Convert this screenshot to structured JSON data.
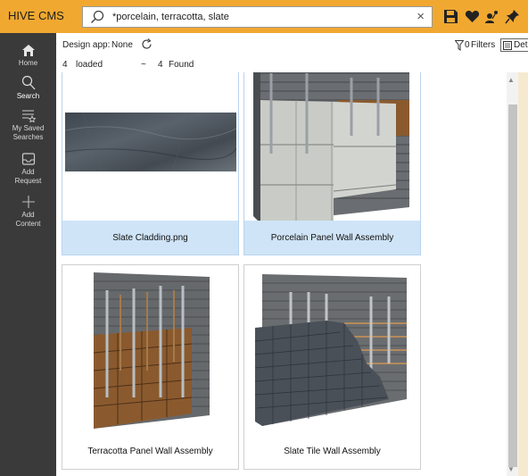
{
  "app": {
    "title": "HIVE CMS"
  },
  "search": {
    "value": "*porcelain, terracotta, slate",
    "clear_label": "×"
  },
  "toolbar_icons": [
    "save-icon",
    "heart-icon",
    "share-user-icon",
    "pin-icon"
  ],
  "sidebar": {
    "items": [
      {
        "label": "Home",
        "icon": "home-icon"
      },
      {
        "label": "Search",
        "icon": "search-icon"
      },
      {
        "label": "My Saved Searches",
        "icon": "saved-searches-icon"
      },
      {
        "label": "Add Request",
        "icon": "add-request-icon"
      },
      {
        "label": "Add Content",
        "icon": "add-content-icon"
      }
    ],
    "home_label": "Home",
    "search_label": "Search",
    "saved_line1": "My Saved",
    "saved_line2": "Searches",
    "request_line1": "Add",
    "request_line2": "Request",
    "content_line1": "Add",
    "content_line2": "Content"
  },
  "info": {
    "design_app_label": "Design app:",
    "design_app_value": "None",
    "loaded_count": "4",
    "loaded_label": "loaded",
    "found_prefix": "~",
    "found_count": "4",
    "found_label": "Found",
    "filters_count": "0",
    "filters_label": "Filters",
    "details_label": "Details"
  },
  "results": [
    {
      "title": "Slate Cladding.png",
      "selected": true
    },
    {
      "title": "Porcelain Panel Wall Assembly",
      "selected": true
    },
    {
      "title": "Terracotta Panel Wall Assembly",
      "selected": false
    },
    {
      "title": "Slate Tile Wall Assembly",
      "selected": false
    }
  ],
  "colors": {
    "accent": "#f0a830",
    "sidebar": "#3a3a3a",
    "selection": "#cfe4f7",
    "terracotta": "#8a5a2e",
    "slate": "#4a5058",
    "porcelain": "#c9ccc6"
  }
}
